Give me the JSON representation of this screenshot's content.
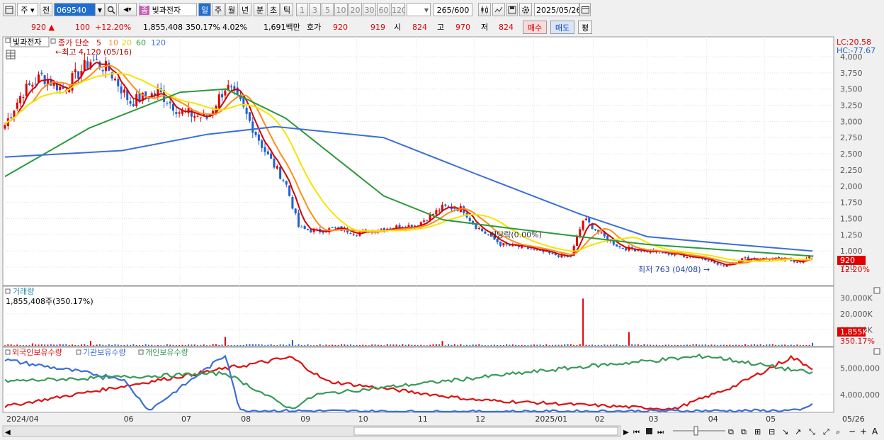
{
  "toolbar": {
    "period_type": "주",
    "prev_label": "전",
    "stock_code": "069540",
    "stock_badge": "종",
    "stock_name": "빛과전자",
    "periods": [
      "일",
      "주",
      "월",
      "년",
      "분",
      "초",
      "틱"
    ],
    "active_period": "일",
    "intervals": [
      "1",
      "3",
      "5",
      "10",
      "20",
      "30",
      "60",
      "120"
    ],
    "count": "265",
    "count_max": "/600",
    "date": "2025/05/26"
  },
  "quote": {
    "price": "920",
    "change": "100",
    "change_pct": "+12.20%",
    "volume": "1,855,408",
    "volume_ratio": "350.17%",
    "turnover": "4.02%",
    "amount": "1,691백만",
    "hoga_label": "호가",
    "ask": "920",
    "bid": "919",
    "open_label": "시",
    "open": "824",
    "high_label": "고",
    "high": "970",
    "low_label": "저",
    "low": "824",
    "buy_label": "매수",
    "sell_label": "매도",
    "avg_label": "평"
  },
  "price_panel": {
    "stock_tag": "빛과전자",
    "ma_title": "종가 단순",
    "ma_periods": [
      "5",
      "10",
      "20",
      "60",
      "120"
    ],
    "max_annotation": "최고 4,120 (05/16)",
    "min_annotation": "최저 763 (04/08)",
    "dividend_annotation": "배당락(0.00%)",
    "lc": "LC:20.58",
    "hc": "HC:-77.67",
    "price_tag": "920",
    "pct_tag": "12.20%"
  },
  "volume_panel": {
    "title": "거래량",
    "summary": "1,855,408주(350.17%)",
    "volume_tag": "1,855K",
    "pct_tag": "350.17%"
  },
  "holding_panel": {
    "titles": [
      "외국인보유수량",
      "기관보유수량",
      "개인보유수량"
    ]
  },
  "x_axis_labels": [
    "2024/04",
    "06",
    "07",
    "08",
    "09",
    "10",
    "11",
    "12",
    "2025/01",
    "02",
    "03",
    "04",
    "05",
    "05/26"
  ],
  "colors": {
    "up": "#e00000",
    "down": "#1f5fcf",
    "ma5": "#d40000",
    "ma10": "#ff8c1a",
    "ma20": "#f5e400",
    "ma60": "#2a9a3a",
    "ma120": "#3b6fd8",
    "foreign": "#e01010",
    "institution": "#3b6fd8",
    "individual": "#3a9a5a"
  },
  "chart_data": [
    {
      "type": "candlestick",
      "title": "빛과전자",
      "y_ticks": [
        "4,000",
        "3,750",
        "3,500",
        "3,250",
        "3,000",
        "2,750",
        "2,500",
        "2,250",
        "2,000",
        "1,750",
        "1,500",
        "1,250",
        "1,000",
        "750"
      ],
      "ylim": [
        750,
        4000
      ],
      "series_names": [
        "5",
        "10",
        "20",
        "60",
        "120"
      ],
      "close_path": [
        [
          "2024/04/01",
          2950
        ],
        [
          "2024/04/10",
          3450
        ],
        [
          "2024/04/20",
          3700
        ],
        [
          "2024/05/01",
          3500
        ],
        [
          "2024/05/16",
          3950
        ],
        [
          "2024/05/25",
          3800
        ],
        [
          "2024/06/05",
          3300
        ],
        [
          "2024/06/20",
          3450
        ],
        [
          "2024/07/01",
          3150
        ],
        [
          "2024/07/15",
          3050
        ],
        [
          "2024/07/25",
          3550
        ],
        [
          "2024/08/01",
          3300
        ],
        [
          "2024/08/15",
          2500
        ],
        [
          "2024/08/25",
          2050
        ],
        [
          "2024/09/01",
          1350
        ],
        [
          "2024/09/10",
          1300
        ],
        [
          "2024/09/20",
          1350
        ],
        [
          "2024/10/01",
          1280
        ],
        [
          "2024/10/15",
          1350
        ],
        [
          "2024/11/01",
          1400
        ],
        [
          "2024/11/15",
          1680
        ],
        [
          "2024/11/25",
          1650
        ],
        [
          "2024/12/01",
          1400
        ],
        [
          "2024/12/15",
          1100
        ],
        [
          "2024/12/27",
          1050
        ],
        [
          "2025/01/10",
          950
        ],
        [
          "2025/01/20",
          900
        ],
        [
          "2025/01/27",
          1500
        ],
        [
          "2025/02/05",
          1250
        ],
        [
          "2025/02/15",
          1050
        ],
        [
          "2025/03/01",
          1000
        ],
        [
          "2025/03/15",
          950
        ],
        [
          "2025/04/01",
          880
        ],
        [
          "2025/04/08",
          763
        ],
        [
          "2025/04/20",
          880
        ],
        [
          "2025/05/05",
          880
        ],
        [
          "2025/05/20",
          840
        ],
        [
          "2025/05/26",
          920
        ]
      ],
      "ma120_path": [
        [
          "2024/04/01",
          2450
        ],
        [
          "2024/06/01",
          2550
        ],
        [
          "2024/07/15",
          2800
        ],
        [
          "2024/08/20",
          2920
        ],
        [
          "2024/10/15",
          2750
        ],
        [
          "2024/12/01",
          2200
        ],
        [
          "2025/01/25",
          1570
        ],
        [
          "2025/03/01",
          1220
        ],
        [
          "2025/04/15",
          1100
        ],
        [
          "2025/05/26",
          1000
        ]
      ],
      "ma60_path": [
        [
          "2024/04/01",
          2150
        ],
        [
          "2024/05/15",
          2900
        ],
        [
          "2024/07/01",
          3450
        ],
        [
          "2024/07/25",
          3500
        ],
        [
          "2024/08/25",
          3050
        ],
        [
          "2024/10/15",
          1850
        ],
        [
          "2024/11/15",
          1480
        ],
        [
          "2024/12/20",
          1350
        ],
        [
          "2025/01/25",
          1220
        ],
        [
          "2025/03/01",
          1100
        ],
        [
          "2025/05/26",
          920
        ]
      ]
    },
    {
      "type": "bar",
      "title": "거래량",
      "y_ticks": [
        "30,000K",
        "20,000K",
        "10,000K"
      ],
      "ylim": [
        0,
        31000
      ],
      "peaks": [
        [
          "2024/04/15",
          1500
        ],
        [
          "2024/05/16",
          3000
        ],
        [
          "2024/07/25",
          5500
        ],
        [
          "2024/08/28",
          3500
        ],
        [
          "2024/11/15",
          3000
        ],
        [
          "2025/01/27",
          29500
        ],
        [
          "2025/02/20",
          8500
        ],
        [
          "2025/05/26",
          1855
        ]
      ]
    },
    {
      "type": "line",
      "title": "보유수량",
      "y_ticks": [
        "5,000,000",
        "4,000,000"
      ],
      "series": [
        {
          "name": "외국인보유수량",
          "values": [
            [
              "2024/04",
              3550000
            ],
            [
              "2024/08/28",
              5400000
            ],
            [
              "2024/09/15",
              4500000
            ],
            [
              "2024/12/01",
              3800000
            ],
            [
              "2025/03/15",
              3450000
            ],
            [
              "2025/04/15",
              4300000
            ],
            [
              "2025/05/15",
              5400000
            ],
            [
              "2025/05/26",
              5000000
            ]
          ]
        },
        {
          "name": "기관보유수량",
          "values": [
            [
              "2024/04",
              5300000
            ],
            [
              "2024/06/01",
              4600000
            ],
            [
              "2024/06/15",
              3400000
            ],
            [
              "2024/07/25",
              5500000
            ],
            [
              "2024/08/01",
              3400000
            ],
            [
              "2024/11/15",
              3350000
            ],
            [
              "2025/05/20",
              3400000
            ],
            [
              "2025/05/26",
              3650000
            ]
          ]
        },
        {
          "name": "개인보유수량",
          "values": [
            [
              "2024/04",
              4500000
            ],
            [
              "2024/07/25",
              4800000
            ],
            [
              "2024/08/28",
              3450000
            ],
            [
              "2024/09/10",
              4000000
            ],
            [
              "2025/01/27",
              5050000
            ],
            [
              "2025/04/01",
              5450000
            ],
            [
              "2025/05/26",
              4800000
            ]
          ]
        }
      ]
    }
  ]
}
